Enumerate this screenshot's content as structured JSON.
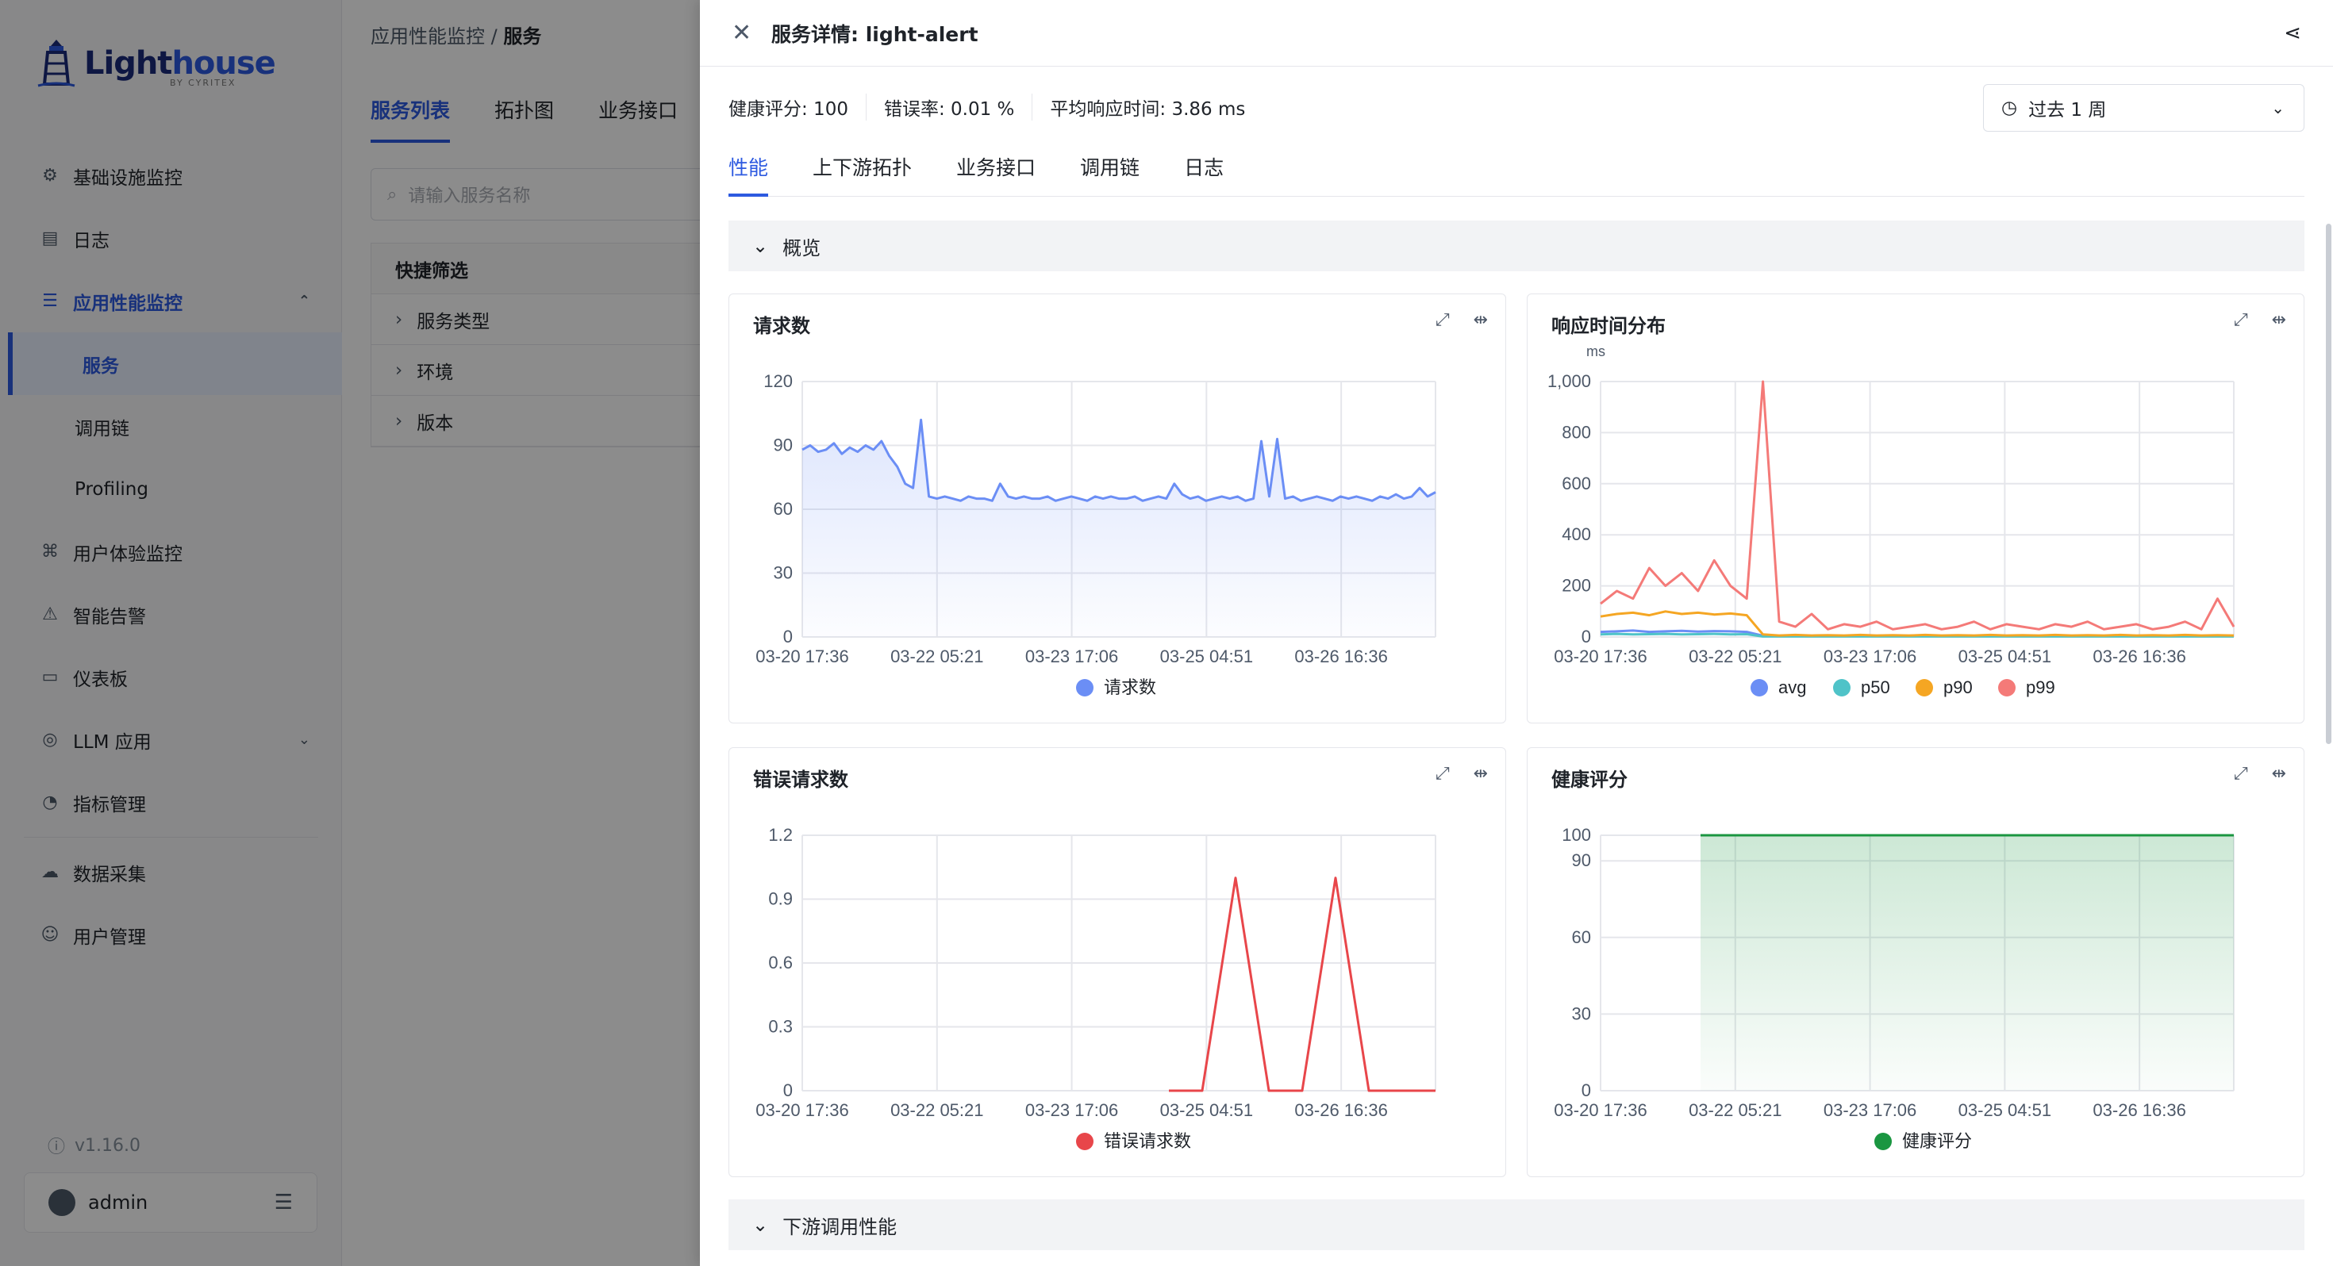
{
  "app": {
    "brand_a": "Light",
    "brand_b": "house",
    "brand_sub": "BY CYRITEX"
  },
  "sidebar": {
    "items": [
      {
        "label": "基础设施监控",
        "icon": "infrastructure-icon"
      },
      {
        "label": "日志",
        "icon": "log-icon"
      },
      {
        "label": "应用性能监控",
        "icon": "apm-icon"
      },
      {
        "label": "用户体验监控",
        "icon": "user-experience-icon"
      },
      {
        "label": "智能告警",
        "icon": "alert-icon"
      },
      {
        "label": "仪表板",
        "icon": "dashboard-icon"
      },
      {
        "label": "LLM 应用",
        "icon": "llm-icon"
      },
      {
        "label": "指标管理",
        "icon": "metrics-icon"
      },
      {
        "label": "数据采集",
        "icon": "data-collection-icon"
      },
      {
        "label": "用户管理",
        "icon": "user-management-icon"
      }
    ],
    "sub_items": [
      "服务",
      "调用链",
      "Profiling"
    ],
    "version": "v1.16.0",
    "user": "admin"
  },
  "main": {
    "breadcrumb_parent": "应用性能监控",
    "breadcrumb_sep": "/",
    "breadcrumb_current": "服务",
    "tabs": [
      "服务列表",
      "拓扑图",
      "业务接口"
    ],
    "search_placeholder": "请输入服务名称",
    "filter_title": "快捷筛选",
    "filters": [
      "服务类型",
      "环境",
      "版本"
    ]
  },
  "drawer": {
    "title": "服务详情: light-alert",
    "metrics": [
      "健康评分:  100",
      "错误率:  0.01 %",
      "平均响应时间:  3.86 ms"
    ],
    "time_range": "过去 1 周",
    "tabs": [
      "性能",
      "上下游拓扑",
      "业务接口",
      "调用链",
      "日志"
    ],
    "section_overview": "概览",
    "section_downstream": "下游调用性能"
  },
  "colors": {
    "accent": "#2d5ae0",
    "requests": "#6b8ef5",
    "errors": "#e8464a",
    "health": "#1a9641",
    "p50": "#4fc3c8",
    "p90": "#f5a623",
    "p99": "#f47a78",
    "avg": "#6b8ef5"
  },
  "chart_data": [
    {
      "type": "area",
      "title": "请求数",
      "x_ticks": [
        "03-20 17:36",
        "03-22 05:21",
        "03-23 17:06",
        "03-25 04:51",
        "03-26 16:36"
      ],
      "ylim": [
        0,
        120
      ],
      "y_ticks": [
        "0",
        "30",
        "60",
        "90",
        "120"
      ],
      "series": [
        {
          "name": "请求数",
          "color": "#6b8ef5",
          "values": [
            88,
            90,
            87,
            88,
            91,
            86,
            89,
            87,
            90,
            88,
            92,
            85,
            80,
            72,
            70,
            102,
            66,
            65,
            66,
            65,
            64,
            66,
            65,
            65,
            64,
            72,
            66,
            65,
            66,
            65,
            65,
            66,
            64,
            65,
            66,
            65,
            64,
            66,
            65,
            66,
            65,
            65,
            66,
            64,
            65,
            66,
            65,
            72,
            67,
            65,
            66,
            64,
            65,
            66,
            65,
            66,
            64,
            65,
            92,
            66,
            93,
            65,
            66,
            64,
            65,
            66,
            65,
            64,
            66,
            65,
            66,
            65,
            64,
            66,
            65,
            67,
            65,
            66,
            70,
            66,
            68
          ]
        }
      ],
      "grid": true,
      "legend": "bottom"
    },
    {
      "type": "line",
      "title": "响应时间分布",
      "unit": "ms",
      "x_ticks": [
        "03-20 17:36",
        "03-22 05:21",
        "03-23 17:06",
        "03-25 04:51",
        "03-26 16:36"
      ],
      "ylim": [
        0,
        1000
      ],
      "y_ticks": [
        "0",
        "200",
        "400",
        "600",
        "800",
        "1,000"
      ],
      "series": [
        {
          "name": "avg",
          "color": "#6b8ef5",
          "values": [
            20,
            22,
            25,
            20,
            22,
            24,
            21,
            23,
            22,
            20,
            5,
            3,
            3,
            3,
            3,
            3,
            3,
            3,
            3,
            3,
            3,
            3,
            3,
            3,
            3,
            3,
            3,
            3,
            3,
            3,
            3,
            3,
            3,
            3,
            3,
            3,
            3,
            3,
            3,
            3
          ]
        },
        {
          "name": "p50",
          "color": "#4fc3c8",
          "values": [
            10,
            12,
            10,
            11,
            12,
            10,
            11,
            12,
            10,
            11,
            2,
            2,
            2,
            2,
            2,
            2,
            2,
            2,
            2,
            2,
            2,
            2,
            2,
            2,
            2,
            2,
            2,
            2,
            2,
            2,
            2,
            2,
            2,
            2,
            2,
            2,
            2,
            2,
            2,
            2
          ]
        },
        {
          "name": "p90",
          "color": "#f5a623",
          "values": [
            80,
            90,
            95,
            85,
            100,
            90,
            95,
            88,
            92,
            85,
            10,
            6,
            8,
            6,
            7,
            6,
            8,
            6,
            7,
            6,
            8,
            6,
            7,
            6,
            8,
            6,
            7,
            6,
            8,
            6,
            7,
            6,
            8,
            6,
            7,
            6,
            8,
            6,
            7,
            6
          ]
        },
        {
          "name": "p99",
          "color": "#f47a78",
          "values": [
            130,
            180,
            150,
            270,
            200,
            250,
            180,
            300,
            200,
            150,
            1000,
            60,
            40,
            90,
            30,
            50,
            40,
            60,
            30,
            40,
            50,
            30,
            40,
            60,
            30,
            50,
            40,
            30,
            50,
            40,
            60,
            30,
            40,
            50,
            30,
            40,
            60,
            30,
            150,
            40
          ]
        }
      ],
      "grid": true,
      "legend": "bottom"
    },
    {
      "type": "line",
      "title": "错误请求数",
      "x_ticks": [
        "03-20 17:36",
        "03-22 05:21",
        "03-23 17:06",
        "03-25 04:51",
        "03-26 16:36"
      ],
      "ylim": [
        0,
        1.2
      ],
      "y_ticks": [
        "0",
        "0.3",
        "0.6",
        "0.9",
        "1.2"
      ],
      "series": [
        {
          "name": "错误请求数",
          "color": "#e8464a",
          "values": [
            null,
            null,
            null,
            null,
            null,
            null,
            null,
            null,
            null,
            null,
            null,
            0,
            0,
            1,
            0,
            0,
            1,
            0,
            0,
            0
          ]
        }
      ],
      "grid": true,
      "legend": "bottom"
    },
    {
      "type": "area",
      "title": "健康评分",
      "x_ticks": [
        "03-20 17:36",
        "03-22 05:21",
        "03-23 17:06",
        "03-25 04:51",
        "03-26 16:36"
      ],
      "ylim": [
        0,
        100
      ],
      "y_ticks": [
        "0",
        "30",
        "60",
        "90",
        "100"
      ],
      "series": [
        {
          "name": "健康评分",
          "color": "#1a9641",
          "values": [
            null,
            null,
            null,
            100,
            100,
            100,
            100,
            100,
            100,
            100,
            100,
            100,
            100,
            100,
            100,
            100,
            100,
            100,
            100,
            100
          ]
        }
      ],
      "grid": true,
      "legend": "bottom"
    }
  ]
}
